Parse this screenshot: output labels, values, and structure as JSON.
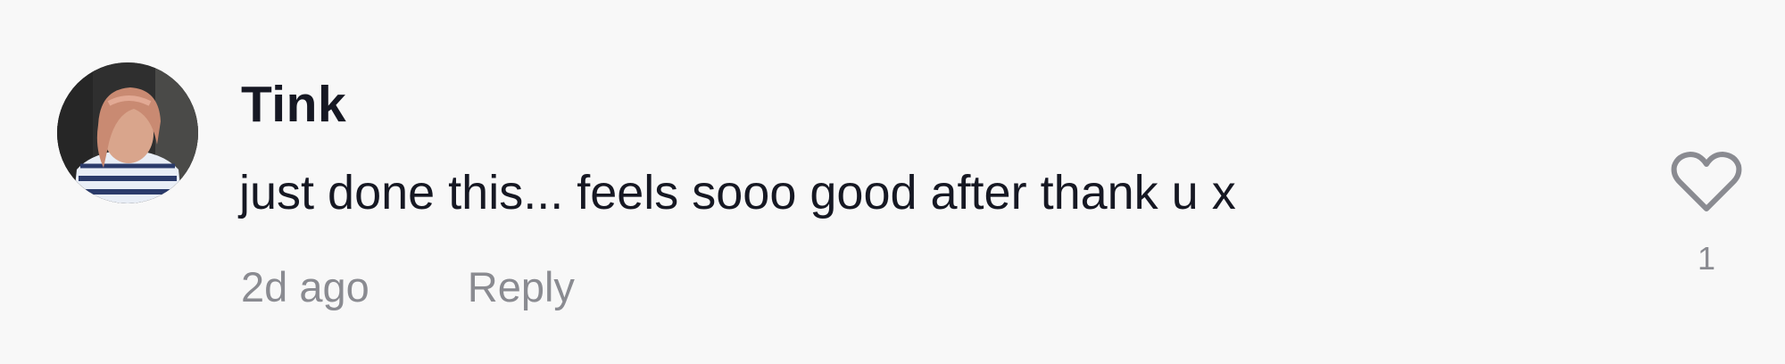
{
  "comment": {
    "username": "Tink",
    "text": "just done this... feels sooo good after thank u x",
    "timestamp": "2d ago",
    "reply_label": "Reply",
    "like_count": "1",
    "avatar_icon": "user-avatar-photo",
    "like_icon": "heart-outline-icon"
  },
  "colors": {
    "background": "#f8f8f8",
    "text_primary": "#161823",
    "text_secondary": "#8a8b91"
  }
}
